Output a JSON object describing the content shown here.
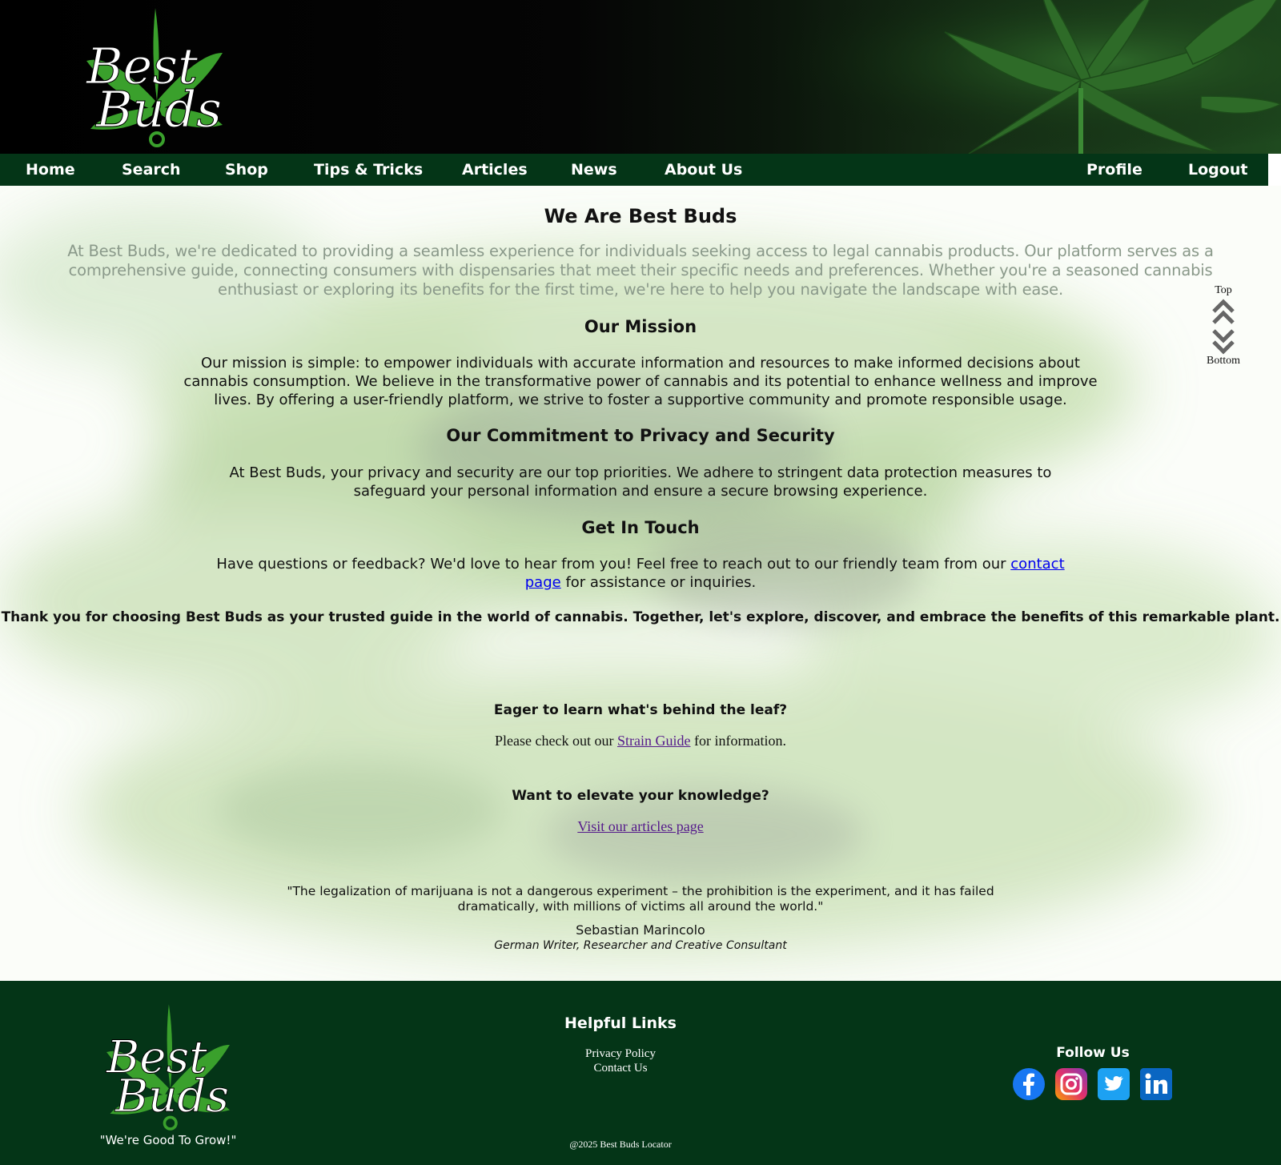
{
  "brand": {
    "logo_text_1": "Best",
    "logo_text_2": "Buds"
  },
  "nav": {
    "left": [
      "Home",
      "Search",
      "Shop",
      "Tips & Tricks",
      "Articles",
      "News",
      "About Us"
    ],
    "right": [
      "Profile",
      "Logout"
    ]
  },
  "main": {
    "title": "We Are Best Buds",
    "intro": "At Best Buds, we're dedicated to providing a seamless experience for individuals seeking access to legal cannabis products. Our platform serves as a comprehensive guide, connecting consumers with dispensaries that meet their specific needs and preferences. Whether you're a seasoned cannabis enthusiast or exploring its benefits for the first time, we're here to help you navigate the landscape with ease.",
    "mission_heading": "Our Mission",
    "mission_text": "Our mission is simple: to empower individuals with accurate information and resources to make informed decisions about cannabis consumption. We believe in the transformative power of cannabis and its potential to enhance wellness and improve lives. By offering a user-friendly platform, we strive to foster a supportive community and promote responsible usage.",
    "privacy_heading": "Our Commitment to Privacy and Security",
    "privacy_text": "At Best Buds, your privacy and security are our top priorities. We adhere to stringent data protection measures to safeguard your personal information and ensure a secure browsing experience.",
    "contact_heading": "Get In Touch",
    "contact_before": "Have questions or feedback? We'd love to hear from you! Feel free to reach out to our friendly team from our ",
    "contact_link": "contact page",
    "contact_after": " for assistance or inquiries.",
    "thanks": "Thank you for choosing Best Buds as your trusted guide in the world of cannabis. Together, let's explore, discover, and embrace the benefits of this remarkable plant.",
    "leaf_heading": "Eager to learn what's behind the leaf?",
    "strain_before": "Please check out our ",
    "strain_link": "Strain Guide",
    "strain_after": " for information.",
    "knowledge_heading": "Want to elevate your knowledge?",
    "articles_link": "Visit our articles page",
    "quote": "\"The legalization of marijuana is not a dangerous experiment – the prohibition is the experiment, and it has failed dramatically, with millions of victims all around the world.\"",
    "quote_author": "Sebastian Marincolo",
    "quote_role": "German Writer, Researcher and Creative Consultant"
  },
  "scroll": {
    "top_label": "Top",
    "bottom_label": "Bottom"
  },
  "footer": {
    "tagline": "\"We're Good To Grow!\"",
    "helpful_heading": "Helpful Links",
    "links": [
      "Privacy Policy",
      "Contact Us"
    ],
    "follow_heading": "Follow Us",
    "social": [
      "facebook-icon",
      "instagram-icon",
      "twitter-icon",
      "linkedin-icon"
    ],
    "copyright": "@2025 Best Buds Locator"
  },
  "colors": {
    "nav_bg": "#043517",
    "footer_bg": "#043517",
    "leaf_green": "#2e8b2a"
  }
}
